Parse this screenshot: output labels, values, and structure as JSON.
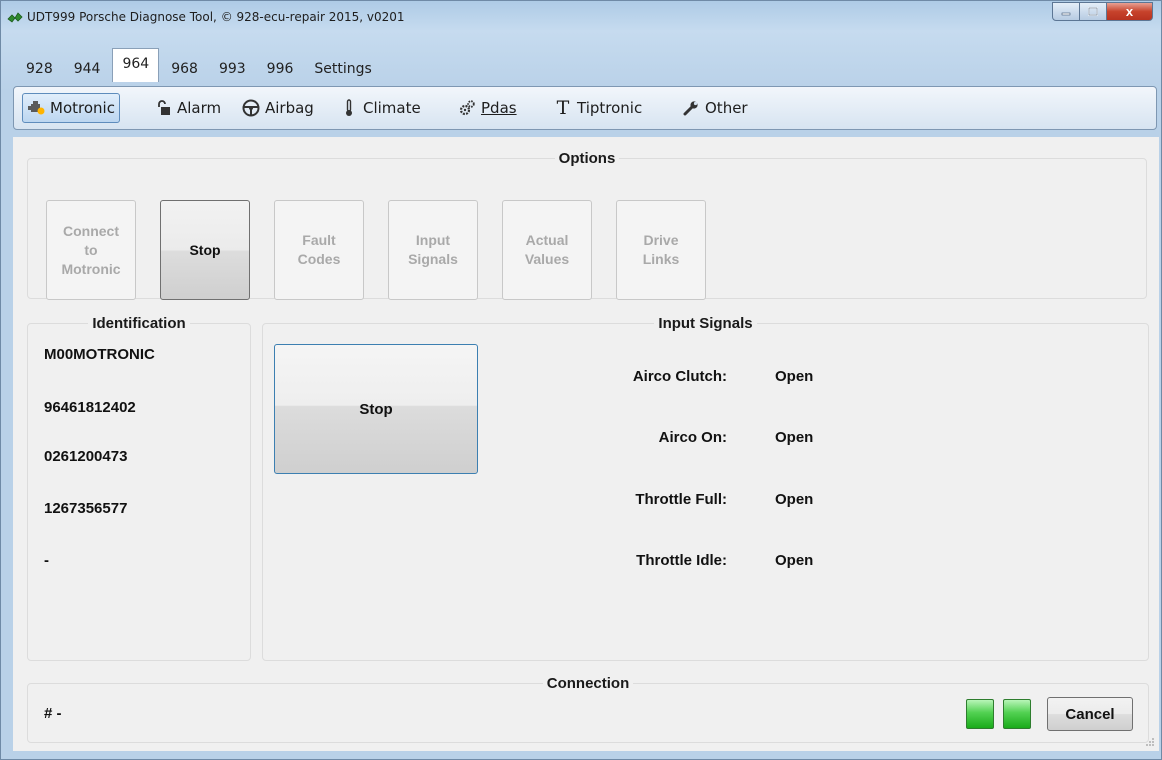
{
  "window": {
    "title": "UDT999 Porsche Diagnose Tool, © 928-ecu-repair 2015, v0201",
    "close_glyph": "x"
  },
  "tabs": [
    {
      "label": "928",
      "active": false
    },
    {
      "label": "944",
      "active": false
    },
    {
      "label": "964",
      "active": true
    },
    {
      "label": "968",
      "active": false
    },
    {
      "label": "993",
      "active": false
    },
    {
      "label": "996",
      "active": false
    },
    {
      "label": "Settings",
      "active": false
    }
  ],
  "toolbar": {
    "items": [
      {
        "label": "Motronic",
        "icon": "engine-icon",
        "active": true
      },
      {
        "label": "Alarm",
        "icon": "lock-icon",
        "active": false
      },
      {
        "label": "Airbag",
        "icon": "steering-wheel-icon",
        "active": false
      },
      {
        "label": "Climate",
        "icon": "thermometer-icon",
        "active": false
      },
      {
        "label": "Pdas",
        "icon": "gears-icon",
        "active": false
      },
      {
        "label": "Tiptronic",
        "icon": "t-letter-icon",
        "active": false
      },
      {
        "label": "Other",
        "icon": "wrench-icon",
        "active": false
      }
    ]
  },
  "options": {
    "title": "Options",
    "buttons": [
      {
        "label": "Connect\nto\nMotronic",
        "enabled": false
      },
      {
        "label": "Stop",
        "enabled": true
      },
      {
        "label": "Fault\nCodes",
        "enabled": false
      },
      {
        "label": "Input\nSignals",
        "enabled": false
      },
      {
        "label": "Actual\nValues",
        "enabled": false
      },
      {
        "label": "Drive\nLinks",
        "enabled": false
      }
    ]
  },
  "identification": {
    "title": "Identification",
    "lines": [
      "M00MOTRONIC",
      "96461812402",
      "0261200473",
      "1267356577",
      "-"
    ]
  },
  "input_signals": {
    "title": "Input Signals",
    "stop_label": "Stop",
    "signals": [
      {
        "label": "Airco Clutch:",
        "value": "Open"
      },
      {
        "label": "Airco On:",
        "value": "Open"
      },
      {
        "label": "Throttle Full:",
        "value": "Open"
      },
      {
        "label": "Throttle Idle:",
        "value": "Open"
      }
    ]
  },
  "connection": {
    "title": "Connection",
    "status_text": "# -",
    "cancel_label": "Cancel"
  },
  "colors": {
    "led_green": "#1aab1a",
    "focus_blue": "#3c7fb1"
  }
}
